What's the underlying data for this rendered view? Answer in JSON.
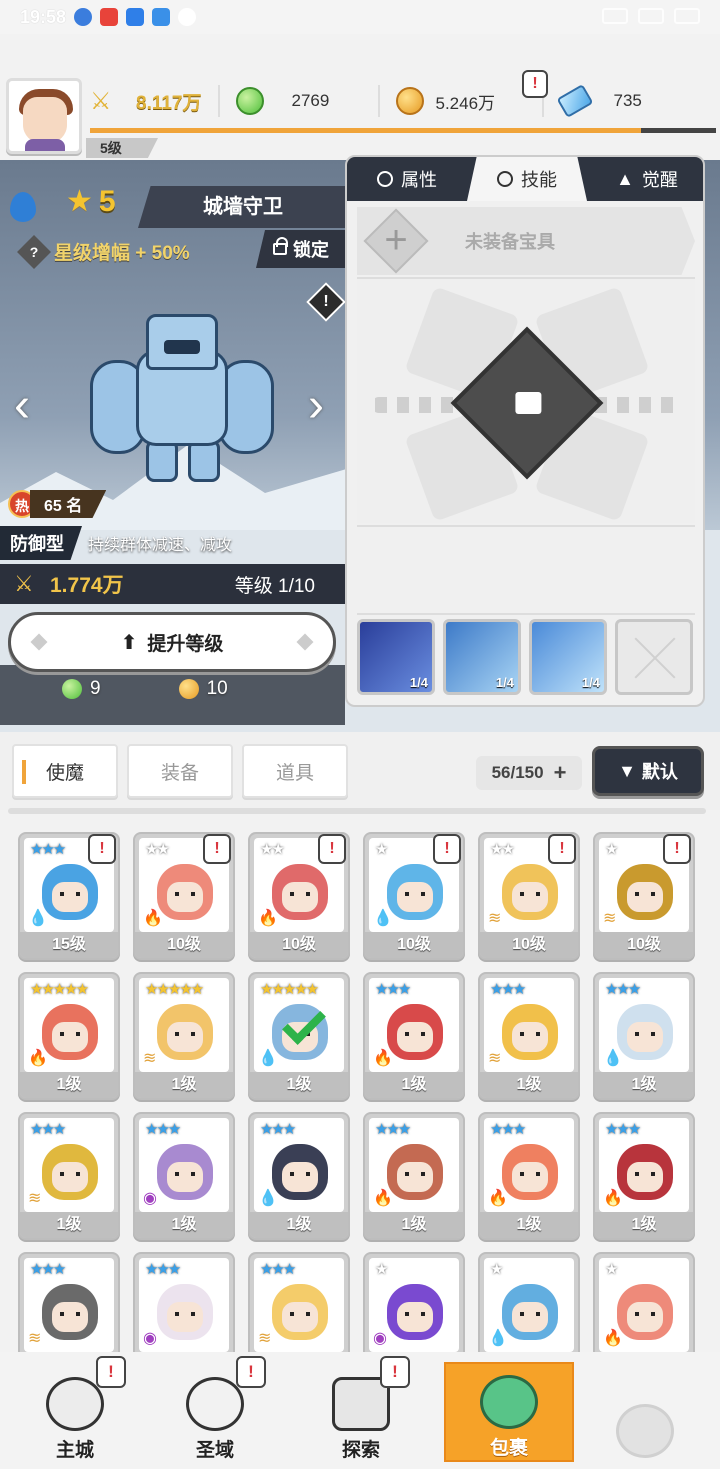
{
  "status_bar": {
    "time": "19:58"
  },
  "player": {
    "level": "5级"
  },
  "resources": {
    "power": "8.117万",
    "green_orb": "2769",
    "gold_coin": "5.246万",
    "crystal": "735",
    "xp_progress": 0.88
  },
  "hero": {
    "stars": "5",
    "star_icon": "star-icon",
    "name": "城墙守卫",
    "star_boost": "星级增幅 + 50%",
    "lock_label": "锁定",
    "rank_hot": "热",
    "rank": "65 名",
    "type": "防御型",
    "description": "持续群体减速、减攻",
    "power": "1.774万",
    "level": "等级 1/10",
    "upgrade_label": "提升等级",
    "cost_green": "9",
    "cost_gold": "10"
  },
  "skill_panel": {
    "tabs": [
      "属性",
      "技能",
      "觉醒"
    ],
    "active_tab": "技能",
    "treasure_label": "未装备宝具",
    "skills": [
      {
        "progress": "1/4"
      },
      {
        "progress": "1/4"
      },
      {
        "progress": "1/4"
      }
    ]
  },
  "inventory": {
    "tabs": [
      "使魔",
      "装备",
      "道具"
    ],
    "active_tab": "使魔",
    "capacity": "56/150",
    "sort_label": "默认",
    "heroes": [
      {
        "stars": "★★★",
        "level": "15级",
        "color": "#4aa3e3",
        "element": "water",
        "badge": "!"
      },
      {
        "stars": "★★",
        "level": "10级",
        "color": "#ee8a7a",
        "element": "fire",
        "badge": "!"
      },
      {
        "stars": "★★",
        "level": "10级",
        "color": "#e06a6a",
        "element": "fire",
        "badge": "!"
      },
      {
        "stars": "★",
        "level": "10级",
        "color": "#5fb5e8",
        "element": "water",
        "badge": "!"
      },
      {
        "stars": "★★",
        "level": "10级",
        "color": "#f0c35a",
        "element": "wind",
        "badge": "!"
      },
      {
        "stars": "★",
        "level": "10级",
        "color": "#c99a2e",
        "element": "wind",
        "badge": "!"
      },
      {
        "stars": "★★★★★",
        "level": "1级",
        "color": "#e8725e",
        "element": "fire",
        "badge": ""
      },
      {
        "stars": "★★★★★",
        "level": "1级",
        "color": "#f2c46a",
        "element": "wind",
        "badge": ""
      },
      {
        "stars": "★★★★★",
        "level": "1级",
        "color": "#86b6de",
        "element": "water",
        "badge": "",
        "selected": true
      },
      {
        "stars": "★★★",
        "level": "1级",
        "color": "#d84a4a",
        "element": "fire",
        "badge": ""
      },
      {
        "stars": "★★★",
        "level": "1级",
        "color": "#f1c04a",
        "element": "wind",
        "badge": ""
      },
      {
        "stars": "★★★",
        "level": "1级",
        "color": "#cfe0ee",
        "element": "water",
        "badge": ""
      },
      {
        "stars": "★★★",
        "level": "1级",
        "color": "#e0b83e",
        "element": "wind",
        "badge": ""
      },
      {
        "stars": "★★★",
        "level": "1级",
        "color": "#a88ad0",
        "element": "dark",
        "badge": ""
      },
      {
        "stars": "★★★",
        "level": "1级",
        "color": "#3a3f55",
        "element": "water",
        "badge": ""
      },
      {
        "stars": "★★★",
        "level": "1级",
        "color": "#c46a52",
        "element": "fire",
        "badge": ""
      },
      {
        "stars": "★★★",
        "level": "1级",
        "color": "#ef8060",
        "element": "fire",
        "badge": ""
      },
      {
        "stars": "★★★",
        "level": "1级",
        "color": "#b8343c",
        "element": "fire",
        "badge": ""
      },
      {
        "stars": "★★★",
        "level": "",
        "color": "#6a6a6a",
        "element": "wind",
        "badge": ""
      },
      {
        "stars": "★★★",
        "level": "",
        "color": "#ece3ee",
        "element": "dark",
        "badge": ""
      },
      {
        "stars": "★★★",
        "level": "",
        "color": "#f4cc6a",
        "element": "wind",
        "badge": ""
      },
      {
        "stars": "★",
        "level": "",
        "color": "#7a4ad0",
        "element": "dark",
        "badge": ""
      },
      {
        "stars": "★",
        "level": "",
        "color": "#62aee0",
        "element": "water",
        "badge": ""
      },
      {
        "stars": "★",
        "level": "",
        "color": "#ee8a7a",
        "element": "fire",
        "badge": ""
      }
    ]
  },
  "bottom_nav": {
    "items": [
      {
        "label": "主城",
        "badge": "!"
      },
      {
        "label": "圣域",
        "badge": "!"
      },
      {
        "label": "探索",
        "badge": "!"
      },
      {
        "label": "包裹",
        "badge": ""
      },
      {
        "label": "",
        "badge": ""
      }
    ]
  },
  "colors": {
    "accent_orange": "#f6a228",
    "xp_orange": "#f0a43a",
    "dark_panel": "#2e3440",
    "power_gold": "#f1c44a"
  }
}
